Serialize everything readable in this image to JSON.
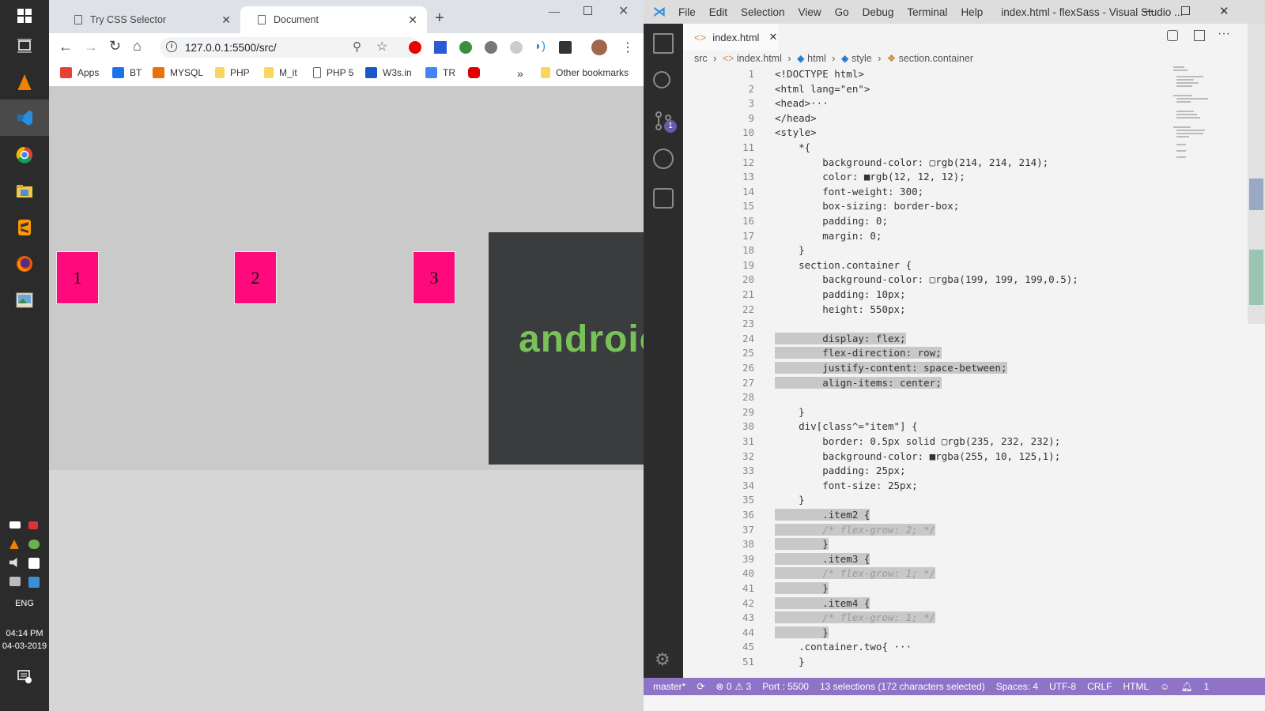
{
  "taskbar": {
    "lang": "ENG",
    "time": "04:14 PM",
    "date": "04-03-2019"
  },
  "chrome": {
    "tabs": [
      {
        "label": "Try CSS Selector"
      },
      {
        "label": "Document"
      }
    ],
    "new_tab": "+",
    "url": "127.0.0.1:5500/src/",
    "bookmarks": [
      {
        "label": "Apps",
        "color": "#e94235"
      },
      {
        "label": "BT",
        "color": "#1a73e8"
      },
      {
        "label": "MYSQL",
        "color": "#e8710a"
      },
      {
        "label": "PHP",
        "color": "#f9d65c"
      },
      {
        "label": "M_it",
        "color": "#f9d65c"
      },
      {
        "label": "PHP 5",
        "color": "#ffffff"
      },
      {
        "label": "W3s.in",
        "color": "#1a57c9"
      },
      {
        "label": "TR",
        "color": "#4285f4"
      },
      {
        "label": "",
        "color": "#e00000"
      }
    ],
    "more": "»",
    "other_bookmarks": "Other bookmarks",
    "page": {
      "items": [
        "1",
        "2",
        "3"
      ],
      "banner_text": "androic"
    }
  },
  "vscode": {
    "menu": [
      "File",
      "Edit",
      "Selection",
      "View",
      "Go",
      "Debug",
      "Terminal",
      "Help"
    ],
    "title": "index.html - flexSass - Visual Studio ...",
    "tab": "index.html",
    "breadcrumbs": [
      "src",
      "index.html",
      "html",
      "style",
      "section.container"
    ],
    "scm_badge": "1",
    "lines": [
      {
        "n": "1",
        "t": "<!DOCTYPE html>"
      },
      {
        "n": "2",
        "t": "<html lang=\"en\">"
      },
      {
        "n": "3",
        "t": "<head>···"
      },
      {
        "n": "9",
        "t": "</head>"
      },
      {
        "n": "10",
        "t": "<style>"
      },
      {
        "n": "11",
        "t": "    *{"
      },
      {
        "n": "12",
        "t": "        background-color: ▢rgb(214, 214, 214);"
      },
      {
        "n": "13",
        "t": "        color: ■rgb(12, 12, 12);"
      },
      {
        "n": "14",
        "t": "        font-weight: 300;"
      },
      {
        "n": "15",
        "t": "        box-sizing: border-box;"
      },
      {
        "n": "16",
        "t": "        padding: 0;"
      },
      {
        "n": "17",
        "t": "        margin: 0;"
      },
      {
        "n": "18",
        "t": "    }"
      },
      {
        "n": "19",
        "t": "    section.container {"
      },
      {
        "n": "20",
        "t": "        background-color: ▢rgba(199, 199, 199,0.5);"
      },
      {
        "n": "21",
        "t": "        padding: 10px;"
      },
      {
        "n": "22",
        "t": "        height: 550px;"
      },
      {
        "n": "23",
        "t": ""
      },
      {
        "n": "24",
        "t": "        display: flex;",
        "hl": true
      },
      {
        "n": "25",
        "t": "        flex-direction: row;",
        "hl": true
      },
      {
        "n": "26",
        "t": "        justify-content: space-between;",
        "hl": true
      },
      {
        "n": "27",
        "t": "        align-items: center;",
        "hl": true
      },
      {
        "n": "28",
        "t": ""
      },
      {
        "n": "29",
        "t": "    }"
      },
      {
        "n": "30",
        "t": "    div[class^=\"item\"] {"
      },
      {
        "n": "31",
        "t": "        border: 0.5px solid ▢rgb(235, 232, 232);"
      },
      {
        "n": "32",
        "t": "        background-color: ■rgba(255, 10, 125,1);"
      },
      {
        "n": "33",
        "t": "        padding: 25px;"
      },
      {
        "n": "34",
        "t": "        font-size: 25px;"
      },
      {
        "n": "35",
        "t": "    }"
      },
      {
        "n": "36",
        "t": "        .item2 {",
        "hl": true
      },
      {
        "n": "37",
        "t": "        /* flex-grow: 2; */",
        "hl": true,
        "cm": true
      },
      {
        "n": "38",
        "t": "        }",
        "hl": true
      },
      {
        "n": "39",
        "t": "        .item3 {",
        "hl": true
      },
      {
        "n": "40",
        "t": "        /* flex-grow: 1; */",
        "hl": true,
        "cm": true
      },
      {
        "n": "41",
        "t": "        }",
        "hl": true
      },
      {
        "n": "42",
        "t": "        .item4 {",
        "hl": true
      },
      {
        "n": "43",
        "t": "        /* flex-grow: 1; */",
        "hl": true,
        "cm": true
      },
      {
        "n": "44",
        "t": "        }",
        "hl": true
      },
      {
        "n": "45",
        "t": "    .container.two{ ···"
      },
      {
        "n": "51",
        "t": "    }"
      }
    ],
    "status": {
      "branch": "master*",
      "errors": "⊗ 0",
      "warnings": "⚠ 3",
      "port": "Port : 5500",
      "selections": "13 selections (172 characters selected)",
      "spaces": "Spaces: 4",
      "encoding": "UTF-8",
      "eol": "CRLF",
      "lang": "HTML",
      "bell": "1"
    }
  },
  "colors": {
    "item_pink": "#ff0a7d",
    "vscode_status": "#8f73c7",
    "android_green": "#78c257"
  }
}
